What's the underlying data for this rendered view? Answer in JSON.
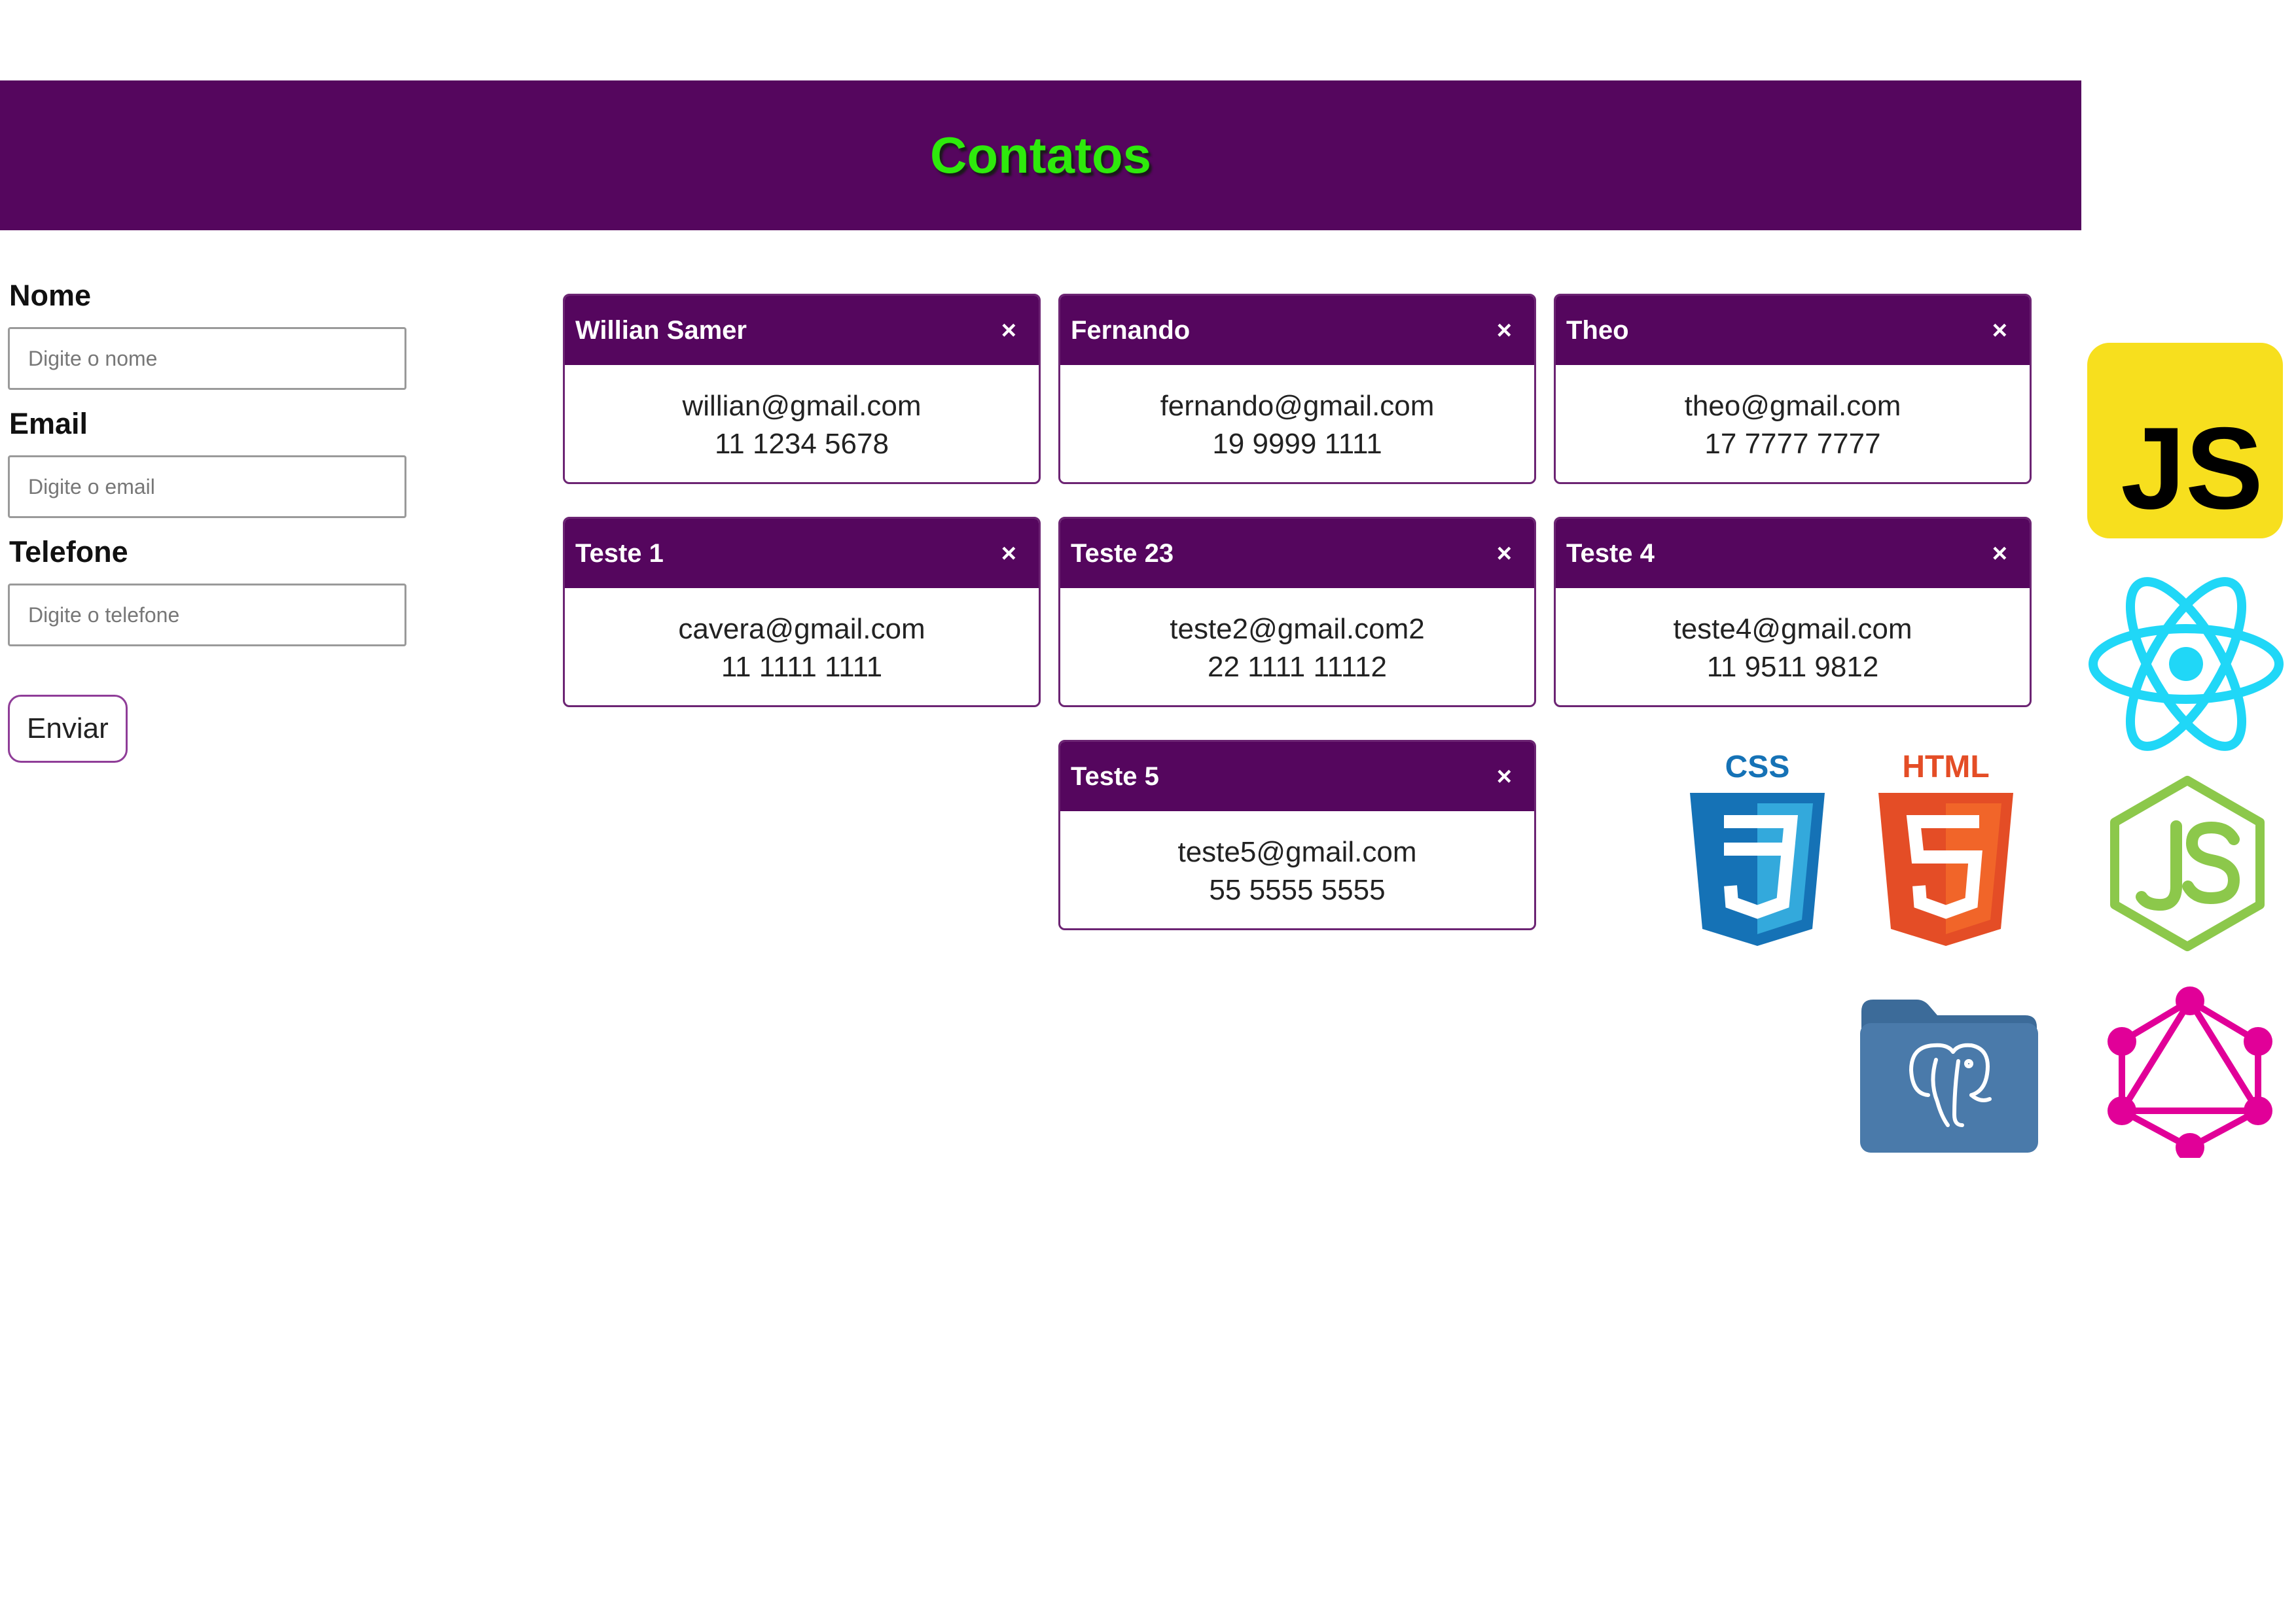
{
  "header": {
    "title": "Contatos"
  },
  "form": {
    "name_label": "Nome",
    "name_placeholder": "Digite o nome",
    "email_label": "Email",
    "email_placeholder": "Digite o email",
    "phone_label": "Telefone",
    "phone_placeholder": "Digite o telefone",
    "submit_label": "Enviar"
  },
  "contacts": [
    {
      "name": "Willian Samer",
      "email": "willian@gmail.com",
      "phone": "11 1234 5678",
      "close": "×"
    },
    {
      "name": "Fernando",
      "email": "fernando@gmail.com",
      "phone": "19 9999 1111",
      "close": "×"
    },
    {
      "name": "Theo",
      "email": "theo@gmail.com",
      "phone": "17 7777 7777",
      "close": "×"
    },
    {
      "name": "Teste 1",
      "email": "cavera@gmail.com",
      "phone": "11 1111 1111",
      "close": "×"
    },
    {
      "name": "Teste 23",
      "email": "teste2@gmail.com2",
      "phone": "22 1111 11112",
      "close": "×"
    },
    {
      "name": "Teste 4",
      "email": "teste4@gmail.com",
      "phone": "11 9511 9812",
      "close": "×"
    },
    {
      "name": "Teste 5",
      "email": "teste5@gmail.com",
      "phone": "55 5555 5555",
      "close": "×"
    }
  ],
  "logos": {
    "js": "JS",
    "css": "CSS",
    "html": "HTML",
    "icons": [
      "javascript-logo-icon",
      "react-logo-icon",
      "nodejs-logo-icon",
      "css3-logo-icon",
      "html5-logo-icon",
      "postgresql-folder-icon",
      "graphql-logo-icon"
    ]
  },
  "colors": {
    "header_bg": "#55065e",
    "title": "#2eea0c",
    "card_border": "#6c2473"
  }
}
